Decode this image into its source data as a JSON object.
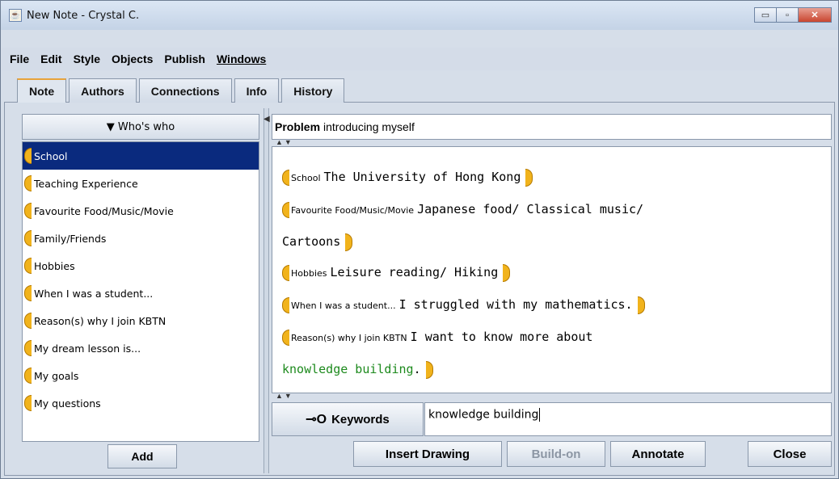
{
  "window": {
    "title": "New Note - Crystal C.",
    "controls": {
      "minimize": "▭",
      "maximize": "▫",
      "close": "✕"
    }
  },
  "menu": [
    "File",
    "Edit",
    "Style",
    "Objects",
    "Publish",
    "Windows"
  ],
  "tabs": [
    "Note",
    "Authors",
    "Connections",
    "Info",
    "History"
  ],
  "active_tab": "Note",
  "scaffolds": {
    "header": "▼ Who's who",
    "items": [
      "School",
      "Teaching Experience",
      "Favourite Food/Music/Movie",
      "Family/Friends",
      "Hobbies",
      "When I was a student...",
      "Reason(s) why I join KBTN",
      "My dream lesson is...",
      "My goals",
      "My questions"
    ],
    "selected_index": 0,
    "add_label": "Add"
  },
  "problem": {
    "label": "Problem",
    "value": "introducing myself"
  },
  "note": {
    "segments": [
      {
        "support": "School",
        "text": "The University of Hong Kong"
      },
      {
        "support": "Favourite Food/Music/Movie",
        "text": "Japanese food/ Classical music/",
        "text_cont": "Cartoons"
      },
      {
        "support": "Hobbies",
        "text": "Leisure reading/ Hiking"
      },
      {
        "support": "When I was a student...",
        "text": "I struggled with my mathematics."
      },
      {
        "support": "Reason(s) why I join KBTN",
        "text": "I want to know more about",
        "text_cont": "knowledge building",
        "text_tail": "."
      }
    ]
  },
  "keywords": {
    "label": "Keywords",
    "value": "knowledge building"
  },
  "buttons": {
    "insert_drawing": "Insert Drawing",
    "build_on": "Build-on",
    "annotate": "Annotate",
    "close": "Close"
  },
  "colors": {
    "selection": "#0a2a7e",
    "scaffold_bracket": "#f1b31c",
    "keyword_text": "#1d8a1d"
  }
}
